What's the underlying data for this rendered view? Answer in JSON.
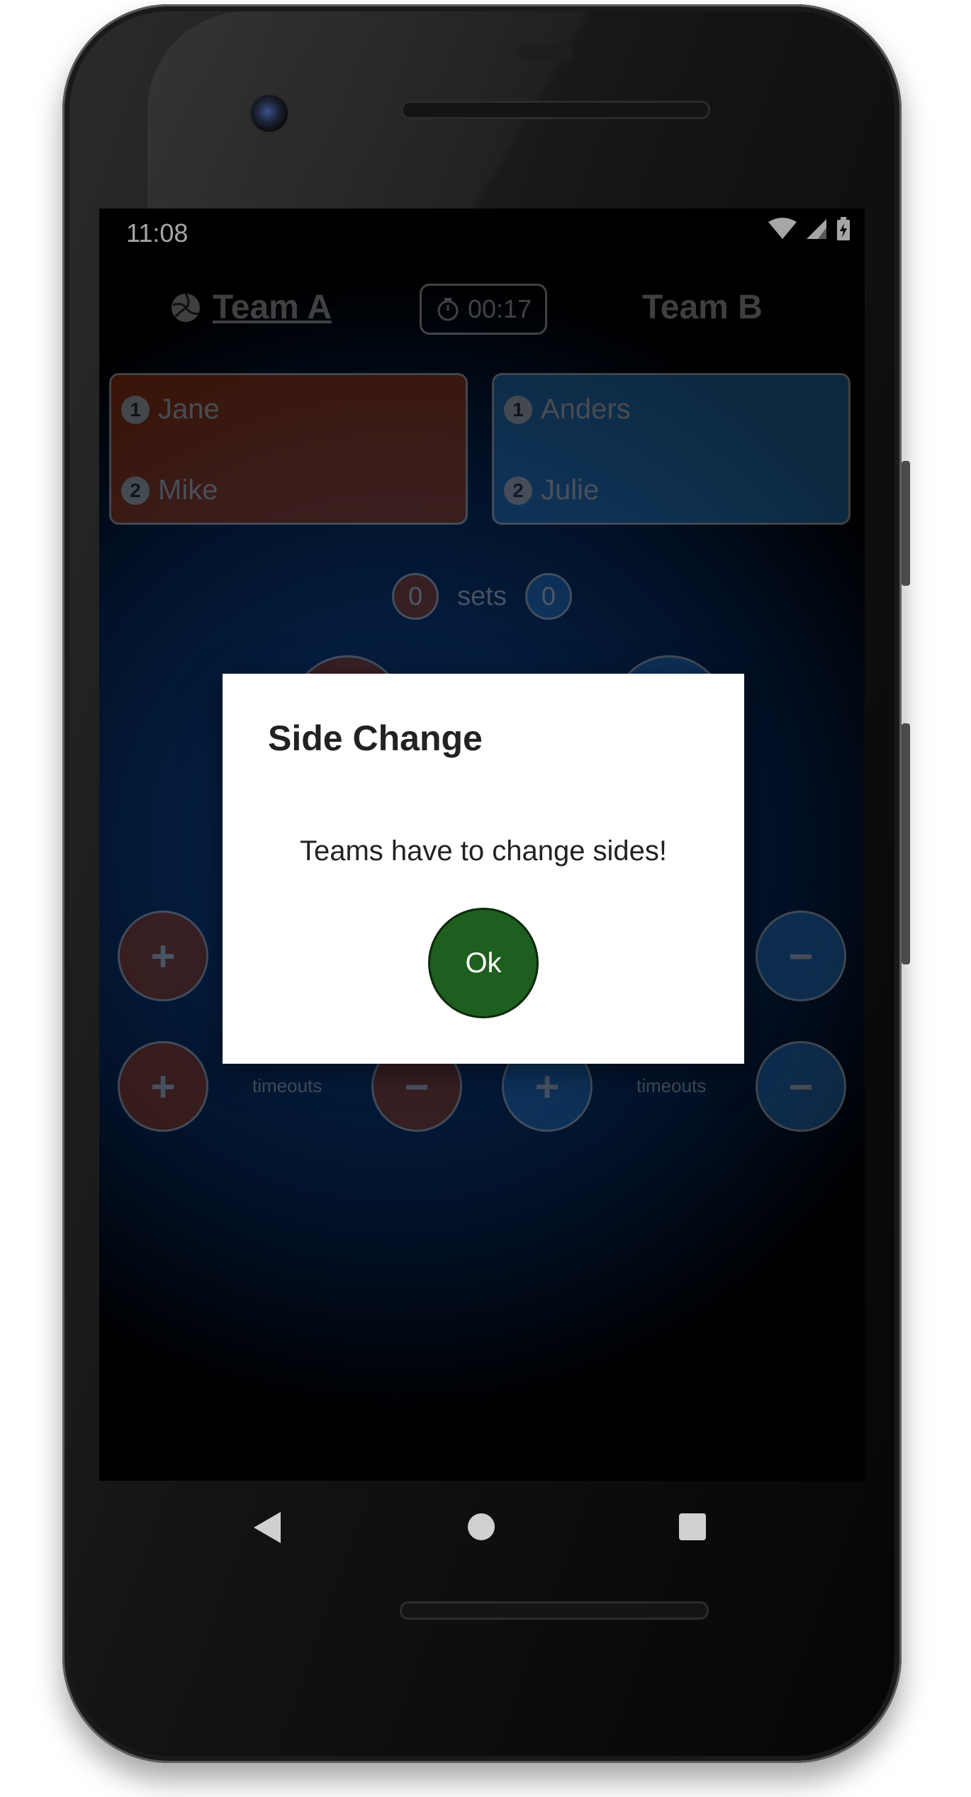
{
  "status_bar": {
    "time": "11:08"
  },
  "header": {
    "team_a": "Team A",
    "team_b": "Team B",
    "timer": "00:17"
  },
  "team_a_players": [
    {
      "number": "1",
      "name": "Jane"
    },
    {
      "number": "2",
      "name": "Mike"
    }
  ],
  "team_b_players": [
    {
      "number": "1",
      "name": "Anders"
    },
    {
      "number": "2",
      "name": "Julie"
    }
  ],
  "sets": {
    "label": "sets",
    "team_a": "0",
    "team_b": "0"
  },
  "controls": {
    "plus": "+",
    "minus": "−",
    "timeouts_label": "timeouts"
  },
  "dialog": {
    "title": "Side Change",
    "message": "Teams have to change sides!",
    "ok_label": "Ok"
  },
  "colors": {
    "team_a": "#c1410f",
    "team_b": "#2f8ad6",
    "ok_button": "#1e5e1e"
  }
}
